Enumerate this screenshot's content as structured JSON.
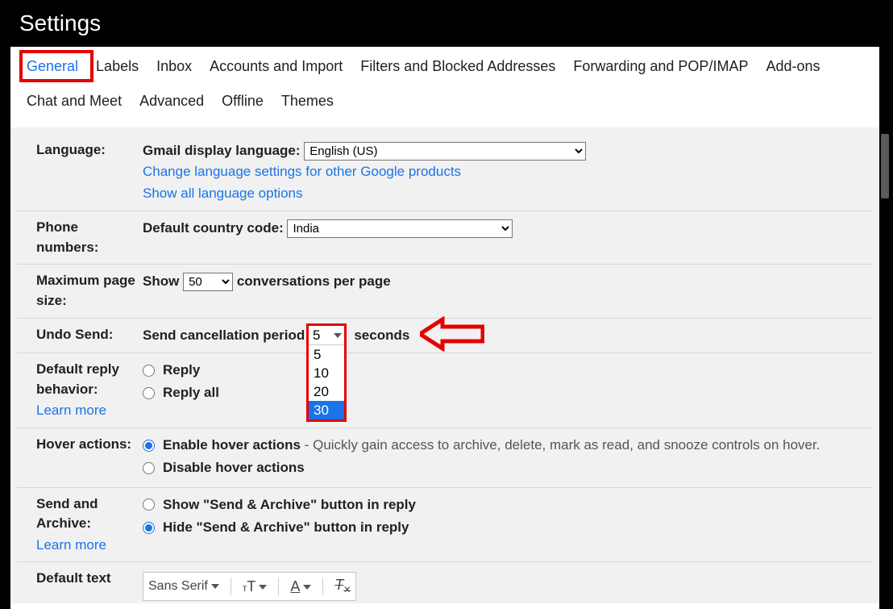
{
  "title": "Settings",
  "tabs": {
    "general": "General",
    "labels": "Labels",
    "inbox": "Inbox",
    "accounts": "Accounts and Import",
    "filters": "Filters and Blocked Addresses",
    "forwarding": "Forwarding and POP/IMAP",
    "addons": "Add-ons",
    "chat": "Chat and Meet",
    "advanced": "Advanced",
    "offline": "Offline",
    "themes": "Themes"
  },
  "language": {
    "section": "Language:",
    "display_label": "Gmail display language:",
    "value": "English (US)",
    "change_link": "Change language settings for other Google products",
    "show_all": "Show all language options"
  },
  "phone": {
    "section": "Phone numbers:",
    "label": "Default country code:",
    "value": "India"
  },
  "pagesize": {
    "section": "Maximum page size:",
    "show": "Show",
    "value": "50",
    "suffix": "conversations per page"
  },
  "undo": {
    "section": "Undo Send:",
    "label": "Send cancellation period:",
    "value": "5",
    "suffix": "seconds",
    "options": [
      "5",
      "10",
      "20",
      "30"
    ]
  },
  "reply": {
    "section": "Default reply behavior:",
    "learn": "Learn more",
    "opt1": "Reply",
    "opt2": "Reply all"
  },
  "hover": {
    "section": "Hover actions:",
    "opt1_label": "Enable hover actions",
    "opt1_desc": " - Quickly gain access to archive, delete, mark as read, and snooze controls on hover.",
    "opt2_label": "Disable hover actions"
  },
  "sendarchive": {
    "section": "Send and Archive:",
    "learn": "Learn more",
    "opt1": "Show \"Send & Archive\" button in reply",
    "opt2": "Hide \"Send & Archive\" button in reply"
  },
  "defaulttext": {
    "section": "Default text",
    "font": "Sans Serif"
  }
}
